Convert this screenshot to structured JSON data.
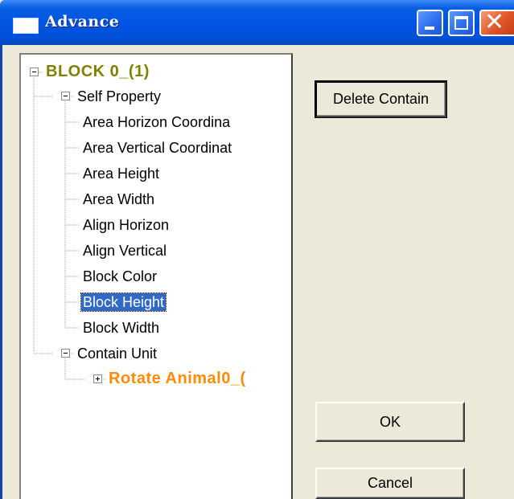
{
  "window": {
    "title": "Advance",
    "controls": [
      "minimize",
      "maximize",
      "close"
    ]
  },
  "tree": {
    "root_label": "BLOCK 0_(1)",
    "self_property_label": "Self Property",
    "self_property_items": [
      "Area Horizon Coordina",
      "Area Vertical Coordinat",
      "Area Height",
      "Area Width",
      "Align Horizon",
      "Align Vertical",
      "Block Color",
      "Block Height",
      "Block Width"
    ],
    "selected_item": "Block Height",
    "contain_unit_label": "Contain Unit",
    "contain_unit_child": "Rotate Animal0_("
  },
  "buttons": {
    "delete_contain": "Delete Contain",
    "ok": "OK",
    "cancel": "Cancel"
  },
  "colors": {
    "title_bar": "#0054e3",
    "root_node": "#808000",
    "child_node": "#ff8c00",
    "selection": "#316ac5"
  }
}
